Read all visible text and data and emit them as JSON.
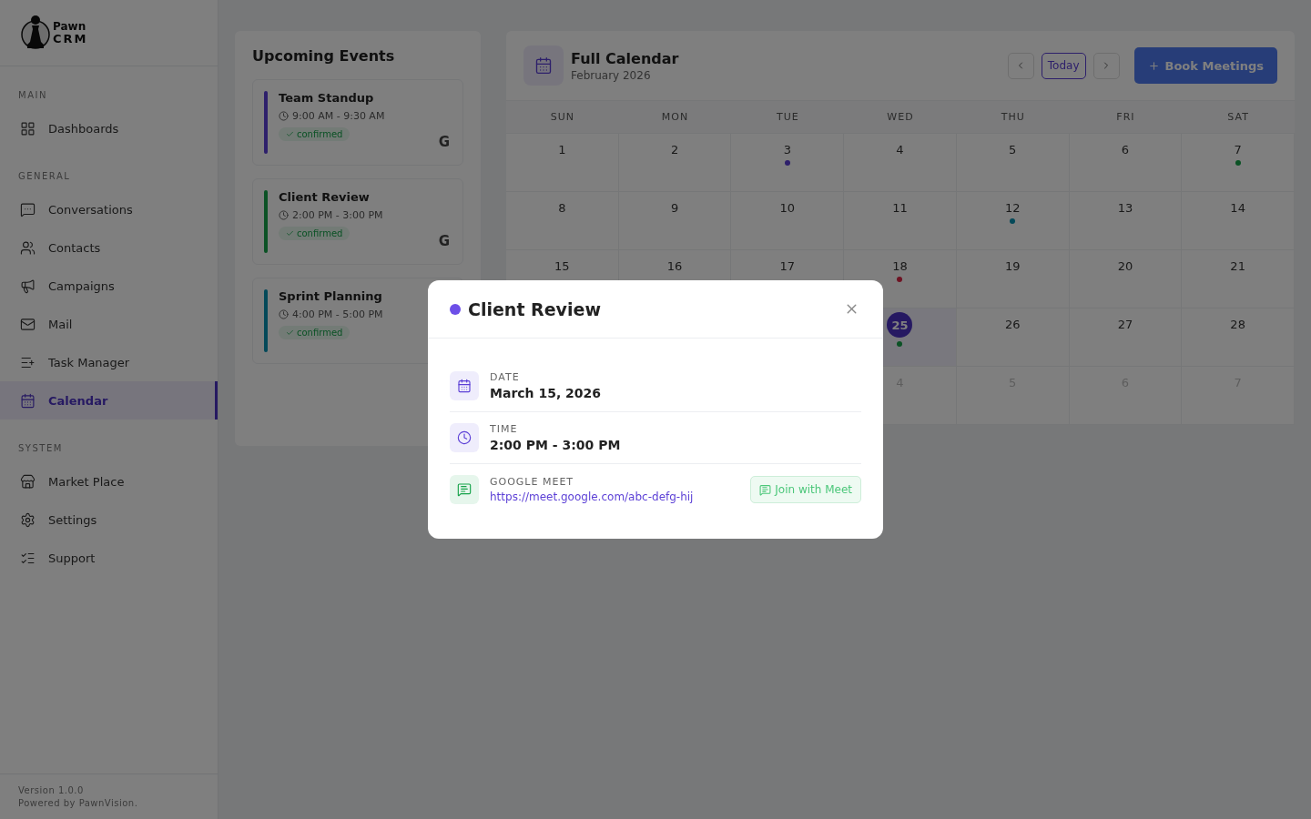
{
  "sidebar": {
    "logo": {
      "line1": "Pawn",
      "line2": "CRM"
    },
    "sections": [
      {
        "title": "MAIN",
        "items": [
          {
            "label": "Dashboards",
            "selected": false
          }
        ]
      },
      {
        "title": "GENERAL",
        "items": [
          {
            "label": "Conversations",
            "selected": false
          },
          {
            "label": "Contacts",
            "selected": false
          },
          {
            "label": "Campaigns",
            "selected": false
          },
          {
            "label": "Mail",
            "selected": false
          },
          {
            "label": "Task Manager",
            "selected": false
          },
          {
            "label": "Calendar",
            "selected": true
          }
        ]
      },
      {
        "title": "SYSTEM",
        "items": [
          {
            "label": "Market Place",
            "selected": false
          },
          {
            "label": "Settings",
            "selected": false
          },
          {
            "label": "Support",
            "selected": false
          }
        ]
      }
    ],
    "footer": {
      "version": "Version 1.0.0",
      "powered": "Powered by PawnVision."
    }
  },
  "upcoming": {
    "title": "Upcoming Events",
    "events": [
      {
        "title": "Team Standup",
        "time": "9:00 AM - 9:30 AM",
        "status": "confirmed",
        "color": "#2e206b",
        "source": "G"
      },
      {
        "title": "Client Review",
        "time": "2:00 PM - 3:00 PM",
        "status": "confirmed",
        "color": "#0b5225",
        "source": "G"
      },
      {
        "title": "Sprint Planning",
        "time": "4:00 PM - 5:00 PM",
        "status": "confirmed",
        "color": "#044959"
      }
    ]
  },
  "calendar": {
    "title": "Full Calendar",
    "subtitle": "February 2026",
    "today_button": "Today",
    "book_button": "Book Meetings",
    "weekdays": [
      "SUN",
      "MON",
      "TUE",
      "WED",
      "THU",
      "FRI",
      "SAT"
    ],
    "weeks": [
      [
        {
          "day": "1"
        },
        {
          "day": "2"
        },
        {
          "day": "3",
          "color": "#2e206b"
        },
        {
          "day": "4"
        },
        {
          "day": "5"
        },
        {
          "day": "6"
        },
        {
          "day": "7",
          "color": "#0b5225"
        }
      ],
      [
        {
          "day": "8"
        },
        {
          "day": "9"
        },
        {
          "day": "10"
        },
        {
          "day": "11"
        },
        {
          "day": "12",
          "color": "#044959"
        },
        {
          "day": "13"
        },
        {
          "day": "14"
        }
      ],
      [
        {
          "day": "15"
        },
        {
          "day": "16"
        },
        {
          "day": "17"
        },
        {
          "day": "18",
          "color": "#6e1323"
        },
        {
          "day": "19"
        },
        {
          "day": "20"
        },
        {
          "day": "21"
        }
      ],
      [
        {
          "day": "25",
          "today": true,
          "color": "#0b5225"
        },
        {
          "day": "26"
        },
        {
          "day": "27"
        },
        {
          "day": "28"
        }
      ],
      [
        {
          "day": "4",
          "outside": true
        },
        {
          "day": "5",
          "outside": true
        },
        {
          "day": "6",
          "outside": true
        },
        {
          "day": "7",
          "outside": true
        }
      ]
    ]
  },
  "modal": {
    "title": "Client Review",
    "color": "#6d4fe8",
    "rows": [
      {
        "kind": "date",
        "label": "DATE",
        "value": "March 15, 2026"
      },
      {
        "kind": "time",
        "label": "TIME",
        "value": "2:00 PM - 3:00 PM"
      },
      {
        "kind": "meet",
        "label": "GOOGLE MEET",
        "value": "https://meet.google.com/abc-defg-hij",
        "button": "Join with Meet"
      }
    ]
  }
}
